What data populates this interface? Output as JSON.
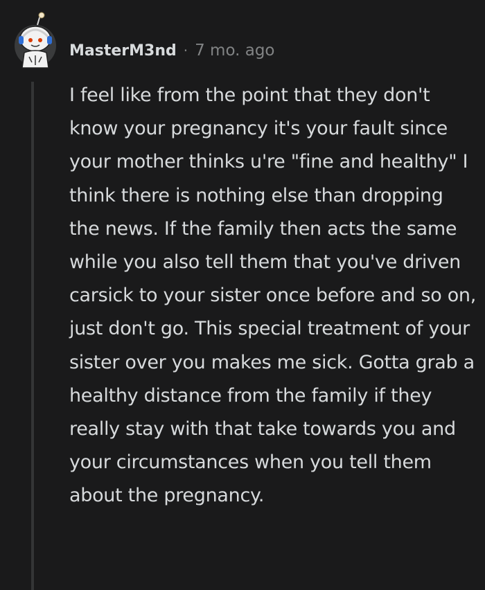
{
  "comment": {
    "author": "MasterM3nd",
    "separator": "·",
    "timestamp": "7 mo. ago",
    "avatar_icon": "snoo-avatar-icon",
    "body": "I feel like from the point that they don't know your pregnancy it's your fault since your mother thinks u're \"fine and healthy\" I think there is nothing else than dropping the news. If the family then acts the same while you also tell them that you've driven carsick to your sister once before and so on, just don't go. This special treatment of your sister over you makes me sick. Gotta grab a healthy distance from the family if they really stay with that take towards you and your circumstances when you tell them about the pregnancy."
  },
  "colors": {
    "background": "#1a1a1b",
    "text": "#d7dadc",
    "meta": "#818384",
    "thread_line": "#343536"
  }
}
